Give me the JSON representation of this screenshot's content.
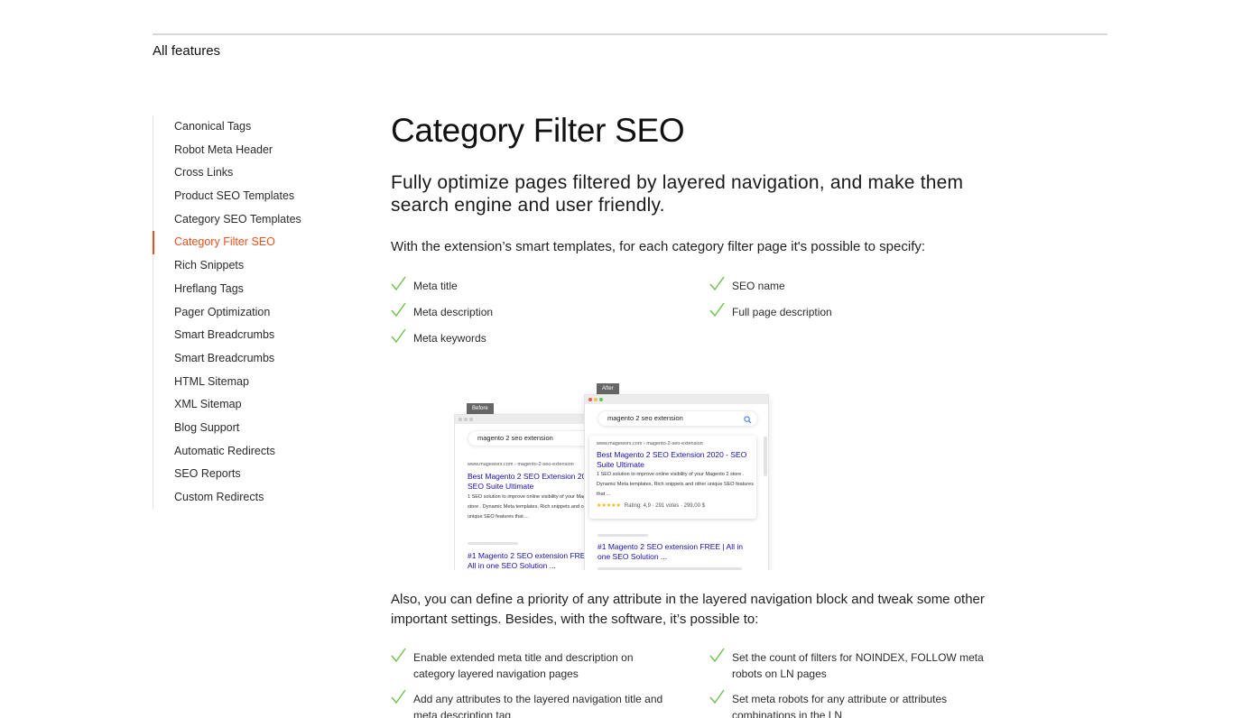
{
  "header": {
    "all_features": "All features"
  },
  "sidebar": {
    "items": [
      {
        "label": "Canonical Tags",
        "active": false
      },
      {
        "label": "Robot Meta Header",
        "active": false
      },
      {
        "label": "Cross Links",
        "active": false
      },
      {
        "label": "Product SEO Templates",
        "active": false
      },
      {
        "label": "Category SEO Templates",
        "active": false
      },
      {
        "label": "Category Filter SEO",
        "active": true
      },
      {
        "label": "Rich Snippets",
        "active": false
      },
      {
        "label": "Hreflang Tags",
        "active": false
      },
      {
        "label": "Pager Optimization",
        "active": false
      },
      {
        "label": "Smart Breadcrumbs",
        "active": false
      },
      {
        "label": "Smart Breadcrumbs",
        "active": false
      },
      {
        "label": "HTML Sitemap",
        "active": false
      },
      {
        "label": "XML Sitemap",
        "active": false
      },
      {
        "label": "Blog Support",
        "active": false
      },
      {
        "label": "Automatic Redirects",
        "active": false
      },
      {
        "label": "SEO Reports",
        "active": false
      },
      {
        "label": "Custom Redirects",
        "active": false
      }
    ]
  },
  "main": {
    "title": "Category Filter SEO",
    "subtitle": "Fully optimize pages filtered by layered navigation, and make them search engine and user friendly.",
    "intro": "With the extension’s smart templates, for each category filter page it's possible to specify:",
    "features": [
      "Meta title",
      "Meta description",
      "Meta keywords",
      "SEO name",
      "Full page description"
    ],
    "outro": "Also, you can define a priority of any attribute in the layered navigation block and tweak some other important settings. Besides, with the software, it’s possible to:",
    "capabilities": [
      "Enable extended meta title and description on category layered navigation pages",
      "Add any attributes to the layered navigation title and meta description tag",
      "Set the count of filters for NOINDEX, FOLLOW meta robots on LN pages",
      "Set meta robots for any attribute or attributes combinations in the LN"
    ]
  },
  "illustration": {
    "before_tag": "Before",
    "after_tag": "After",
    "query": "magento 2 seo extension",
    "before_result": {
      "url": "www.mageworx.com › magento-2-seo-extension",
      "title": "Best Magento 2 SEO Extension 2020 - SEO Suite Ultimate",
      "desc": "1 SEO solution to improve online visibility of your Magento 2 store . Dynamic Meta templates, Rich snippets and other unique SEO features that ..."
    },
    "before_result2_title": "#1 Magento 2 SEO extension FREE | All in one SEO Solution ...",
    "after_result": {
      "url": "www.mageworx.com › magento-2-seo-extension",
      "title": "Best Magento 2 SEO Extension 2020 - SEO Suite Ultimate",
      "desc": "1 SEO solution to improve online visibility of your Magento 2 store . Dynamic Meta templates, Rich snippets and other unique SEO features that ...",
      "stars": "★★★★★",
      "rating": "Rating: 4,9 · 291 votes · 299,00 $"
    },
    "after_result2_title": "#1 Magento 2 SEO extension FREE | All in one SEO Solution ...",
    "colors": {
      "accent": "#e8501e",
      "check": "#6cc04a",
      "link": "#1a0dab",
      "star": "#f4b400"
    }
  }
}
